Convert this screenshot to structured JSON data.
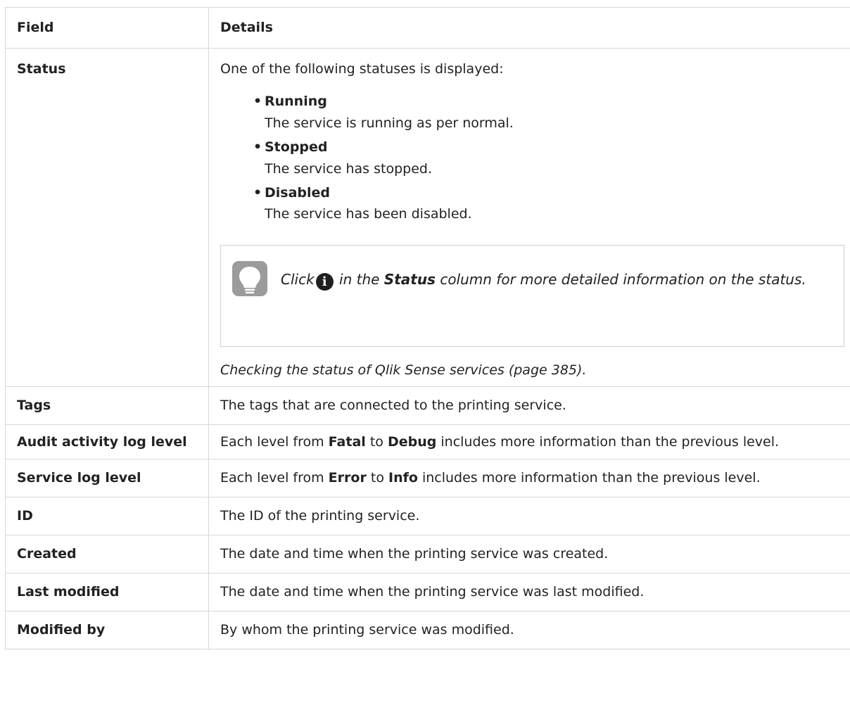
{
  "table": {
    "header": {
      "field": "Field",
      "details": "Details"
    },
    "status": {
      "field": "Status",
      "intro": "One of the following statuses is displayed:",
      "items": [
        {
          "name": "Running",
          "desc": "The service is running as per normal."
        },
        {
          "name": "Stopped",
          "desc": "The service has stopped."
        },
        {
          "name": "Disabled",
          "desc": "The service has been disabled."
        }
      ],
      "bullet": "•",
      "tip": {
        "icon": "lightbulb-icon",
        "before": "Click",
        "info_icon": "info-circle-icon",
        "info_glyph": "i",
        "middle": "in the",
        "strong": "Status",
        "after": "column for more detailed information on the status."
      },
      "link": "Checking the status of Qlik Sense services (page 385)",
      "link_suffix": "."
    },
    "tags": {
      "field": "Tags",
      "details": "The tags that are connected to the printing service."
    },
    "audit": {
      "field": "Audit activity log level",
      "prefix": "Each level from",
      "from": "Fatal",
      "to_word": "to",
      "to": "Debug",
      "suffix": "includes more information than the previous level."
    },
    "service_log": {
      "field": "Service log level",
      "prefix": "Each level from",
      "from": "Error",
      "to_word": "to",
      "to": "Info",
      "suffix": "includes more information than the previous level."
    },
    "id": {
      "field": "ID",
      "details": "The ID of the printing service."
    },
    "created": {
      "field": "Created",
      "details": "The date and time when the printing service was created."
    },
    "last_modified": {
      "field": "Last modified",
      "details": "The date and time when the printing service was last modified."
    },
    "modified_by": {
      "field": "Modified by",
      "details": "By whom the printing service was modified."
    }
  }
}
